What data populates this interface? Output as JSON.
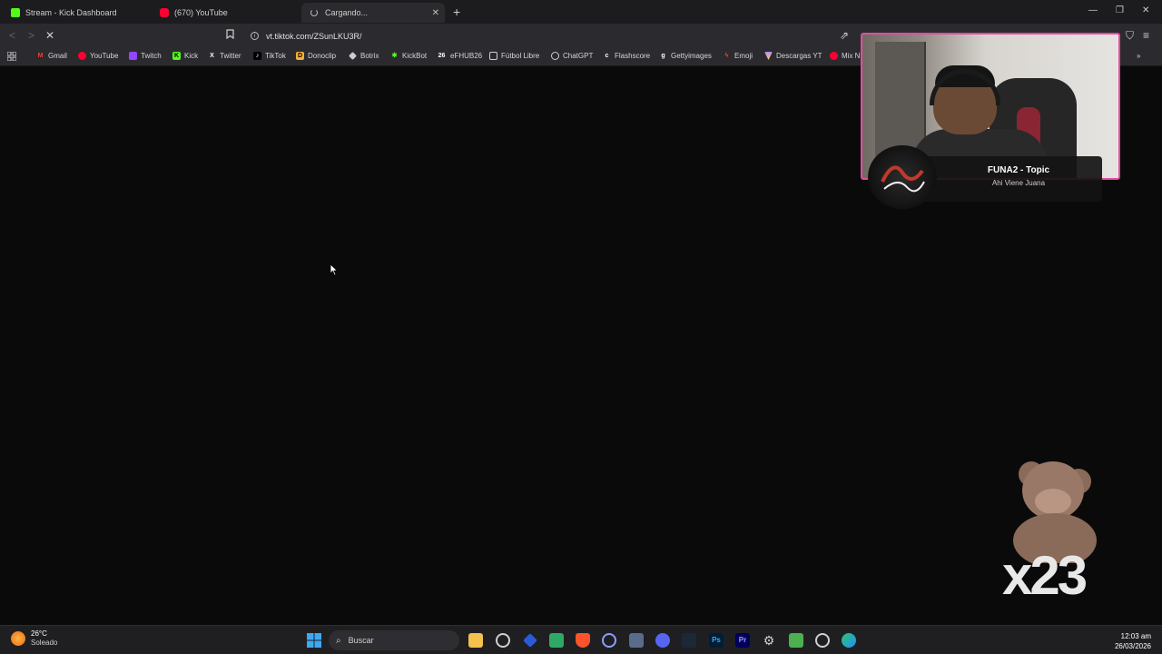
{
  "tabs": [
    {
      "label": "Stream - Kick Dashboard",
      "icon": "kick-icon"
    },
    {
      "label": "(670) YouTube",
      "icon": "youtube-icon"
    },
    {
      "label": "Cargando...",
      "icon": "loading-spinner-icon",
      "active": true
    }
  ],
  "address": {
    "url": "vt.tiktok.com/ZSunLKU3R/"
  },
  "bookmarks": [
    {
      "label": "Gmail",
      "icon": "gmail-icon",
      "color": "#ea4335"
    },
    {
      "label": "YouTube",
      "icon": "youtube-icon",
      "color": "#ff0033"
    },
    {
      "label": "Twitch",
      "icon": "twitch-icon",
      "color": "#9146ff"
    },
    {
      "label": "Kick",
      "icon": "kick-icon",
      "color": "#53fc18"
    },
    {
      "label": "Twitter",
      "icon": "x-icon",
      "color": "#ffffff"
    },
    {
      "label": "TikTok",
      "icon": "tiktok-icon",
      "color": "#25f4ee"
    },
    {
      "label": "Donoclip",
      "icon": "donoclip-icon",
      "color": "#f2b134"
    },
    {
      "label": "Botrix",
      "icon": "botrix-icon",
      "color": "#cccccc"
    },
    {
      "label": "KickBot",
      "icon": "kickbot-icon",
      "color": "#53fc18"
    },
    {
      "label": "eFHUB26",
      "icon": "efhub-icon",
      "color": "#e0e0e0"
    },
    {
      "label": "Fútbol Libre",
      "icon": "futbol-icon",
      "color": "#7ed957"
    },
    {
      "label": "ChatGPT",
      "icon": "chatgpt-icon",
      "color": "#cfcfcf"
    },
    {
      "label": "Flashscore",
      "icon": "flashscore-icon",
      "color": "#cfcfcf"
    },
    {
      "label": "Gettyimages",
      "icon": "getty-icon",
      "color": "#ffffff"
    },
    {
      "label": "Emoji",
      "icon": "emoji-icon",
      "color": "#ff3b3b"
    },
    {
      "label": "Descargas YT",
      "icon": "descargas-icon",
      "color": "#b388ff"
    },
    {
      "label": "Mix N",
      "icon": "youtube-icon",
      "color": "#ff0033"
    }
  ],
  "overlay": {
    "song_title": "FUNA2 - Topic",
    "song_artist": "Ahi Viene Juana",
    "counter": "x23"
  },
  "taskbar": {
    "weather_temp": "26°C",
    "weather_desc": "Soleado",
    "search_placeholder": "Buscar",
    "time": "12:03 am",
    "date": "26/03/2026"
  }
}
